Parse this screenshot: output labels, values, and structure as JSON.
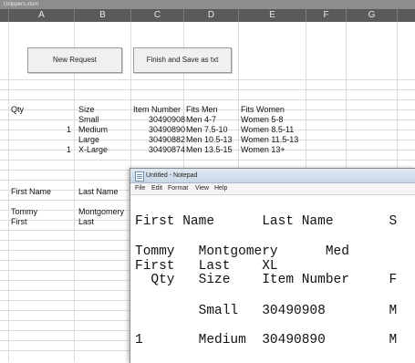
{
  "window": {
    "title": "Unippers.xlsm"
  },
  "columns": [
    "A",
    "B",
    "C",
    "D",
    "E",
    "F",
    "G"
  ],
  "buttons": {
    "new_request": "New Request",
    "finish_save": "Finish and Save as txt"
  },
  "sheet": {
    "headers": {
      "qty": "Qty",
      "size": "Size",
      "item_number": "Item Number",
      "fits_men": "Fits Men",
      "fits_women": "Fits Women"
    },
    "sizes": [
      {
        "qty": "",
        "size": "Small",
        "item": "30490908",
        "men": "Men 4-7",
        "women": "Women 5-8"
      },
      {
        "qty": "1",
        "size": "Medium",
        "item": "30490890",
        "men": "Men 7.5-10",
        "women": "Women 8.5-11"
      },
      {
        "qty": "",
        "size": "Large",
        "item": "30490882",
        "men": "Men 10.5-13",
        "women": "Women 11.5-13"
      },
      {
        "qty": "1",
        "size": "X-Large",
        "item": "30490874",
        "men": "Men 13.5-15",
        "women": "Women 13+"
      }
    ],
    "names_header": {
      "first": "First Name",
      "last": "Last Name"
    },
    "names": [
      {
        "first": "Tommy",
        "last": "Montgomery"
      },
      {
        "first": "First",
        "last": "Last"
      }
    ]
  },
  "notepad": {
    "title": "Untitled - Notepad",
    "menu": [
      "File",
      "Edit",
      "Format",
      "View",
      "Help"
    ],
    "lines": [
      "First Name      Last Name       S",
      "",
      "Tommy   Montgomery      Med",
      "First   Last    XL",
      "  Qty   Size    Item Number     F",
      "",
      "        Small   30490908        M",
      "",
      "1       Medium  30490890        M"
    ]
  }
}
